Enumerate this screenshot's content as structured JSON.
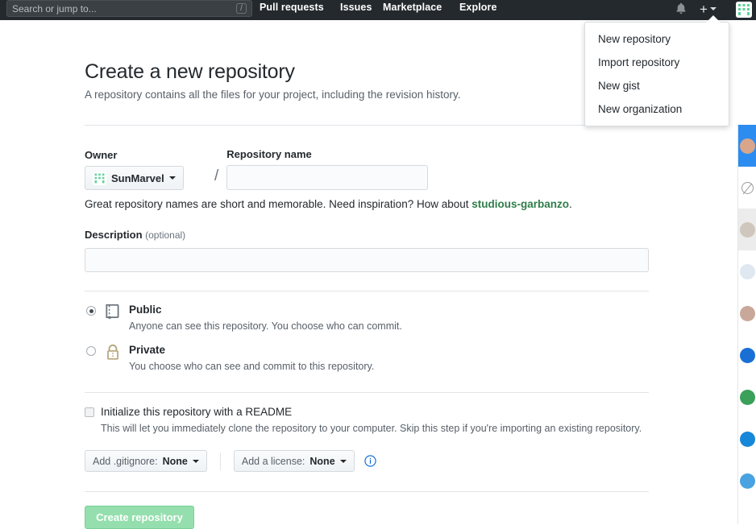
{
  "header": {
    "search": {
      "placeholder": "Search or jump to...",
      "shortcut_key": "/"
    },
    "nav": [
      {
        "label": "Pull requests"
      },
      {
        "label": "Issues"
      },
      {
        "label": "Marketplace"
      },
      {
        "label": "Explore"
      }
    ],
    "icons": {
      "notifications": "bell-icon",
      "create_new": "plus-icon",
      "profile": "avatar-icon"
    },
    "background_color": "#24292e"
  },
  "create_menu": {
    "open": true,
    "items": [
      {
        "label": "New repository"
      },
      {
        "label": "Import repository"
      },
      {
        "label": "New gist"
      },
      {
        "label": "New organization"
      }
    ]
  },
  "page": {
    "title": "Create a new repository",
    "subtitle": "A repository contains all the files for your project, including the revision history."
  },
  "form": {
    "owner": {
      "label": "Owner",
      "selected": "SunMarvel",
      "avatar_color": "#5fd39a"
    },
    "separator": "/",
    "repository_name": {
      "label": "Repository name",
      "value": "",
      "placeholder": ""
    },
    "hint": {
      "prefix": "Great repository names are short and memorable. Need inspiration? How about ",
      "suggestion": "studious-garbanzo",
      "suffix": ".",
      "suggestion_color": "#2f7d4b"
    },
    "description": {
      "label": "Description",
      "optional_note": "(optional)",
      "value": "",
      "placeholder": ""
    },
    "visibility": {
      "options": [
        {
          "id": "public",
          "title": "Public",
          "description": "Anyone can see this repository. You choose who can commit.",
          "selected": true,
          "icon": "repo-book-icon"
        },
        {
          "id": "private",
          "title": "Private",
          "description": "You choose who can see and commit to this repository.",
          "selected": false,
          "icon": "lock-icon"
        }
      ]
    },
    "readme": {
      "label": "Initialize this repository with a README",
      "description": "This will let you immediately clone the repository to your computer. Skip this step if you're importing an existing repository.",
      "checked": false
    },
    "gitignore": {
      "prefix": "Add .gitignore:",
      "value": "None"
    },
    "license": {
      "prefix": "Add a license:",
      "value": "None",
      "info_icon": "info-icon"
    },
    "submit": {
      "label": "Create repository",
      "color": "#94dfad",
      "enabled": false
    }
  },
  "right_strip": {
    "items": [
      {
        "type": "avatar",
        "state": "active",
        "color": "#d9a68b"
      },
      {
        "type": "clock",
        "state": "normal",
        "color": "#9b9b9b"
      },
      {
        "type": "avatar",
        "state": "shade",
        "color": "#cfc6bd"
      },
      {
        "type": "avatar",
        "state": "normal",
        "color": "#dfe8f0"
      },
      {
        "type": "avatar",
        "state": "normal",
        "color": "#c9a89a"
      },
      {
        "type": "avatar",
        "state": "normal",
        "color": "#1a6fd4"
      },
      {
        "type": "avatar",
        "state": "normal",
        "color": "#3aa05a"
      },
      {
        "type": "avatar",
        "state": "normal",
        "color": "#1787d8"
      },
      {
        "type": "avatar",
        "state": "normal",
        "color": "#4aa3e0"
      }
    ]
  }
}
